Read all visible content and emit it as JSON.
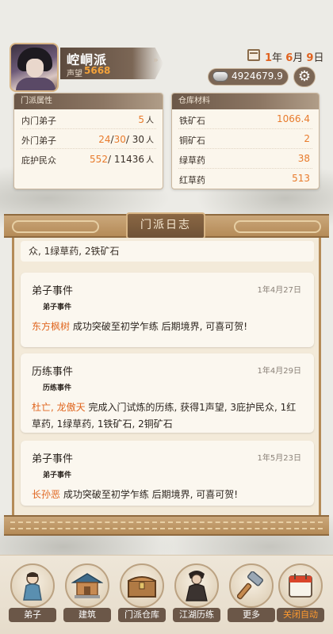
{
  "header": {
    "sect_name": "崆峒派",
    "fame_label": "声望",
    "fame_value": "5668",
    "date": {
      "year": "1",
      "year_suffix": "年",
      "month": "6",
      "month_suffix": "月",
      "day": "9",
      "day_suffix": "日"
    },
    "silver": "4924679.9"
  },
  "sect_card": {
    "title": "门派属性",
    "rows": [
      {
        "label": "内门弟子",
        "value": "5",
        "unit": "人"
      },
      {
        "label": "外门弟子",
        "v1": "24",
        "v2": "30",
        "v3": "30",
        "unit": "人"
      },
      {
        "label": "庇护民众",
        "v1": "552",
        "v2": "11436",
        "unit": "人"
      }
    ]
  },
  "storage_card": {
    "title": "仓库材料",
    "rows": [
      {
        "label": "铁矿石",
        "value": "1066.4"
      },
      {
        "label": "铜矿石",
        "value": "2"
      },
      {
        "label": "绿草药",
        "value": "38"
      },
      {
        "label": "红草药",
        "value": "513"
      }
    ]
  },
  "log": {
    "title": "门派日志",
    "fragment": "众, 1绿草药, 2铁矿石",
    "entries": [
      {
        "type": "弟子事件",
        "date": "1年4月27日",
        "sub": "弟子事件",
        "who": "东方枫树",
        "text": " 成功突破至初学乍练 后期境界, 可喜可贺!"
      },
      {
        "type": "历练事件",
        "date": "1年4月29日",
        "sub": "历练事件",
        "who": "杜亡, 龙傲天",
        "text": " 完成入门试炼的历练, 获得1声望, 3庇护民众, 1红草药, 1绿草药, 1铁矿石, 2铜矿石"
      },
      {
        "type": "弟子事件",
        "date": "1年5月23日",
        "sub": "弟子事件",
        "who": "长孙恶",
        "text": " 成功突破至初学乍练 后期境界, 可喜可贺!"
      }
    ]
  },
  "nav": {
    "items": [
      {
        "label": "弟子",
        "icon": "disciple-icon"
      },
      {
        "label": "建筑",
        "icon": "building-icon"
      },
      {
        "label": "门派仓库",
        "icon": "chest-icon"
      },
      {
        "label": "江湖历练",
        "icon": "warrior-icon"
      },
      {
        "label": "更多",
        "icon": "hammer-icon"
      },
      {
        "label": "关闭自动",
        "icon": "calendar-icon"
      }
    ]
  },
  "colors": {
    "accent_orange": "#e87b2c",
    "panel_brown": "#6b5748",
    "gold": "#caa77a"
  }
}
